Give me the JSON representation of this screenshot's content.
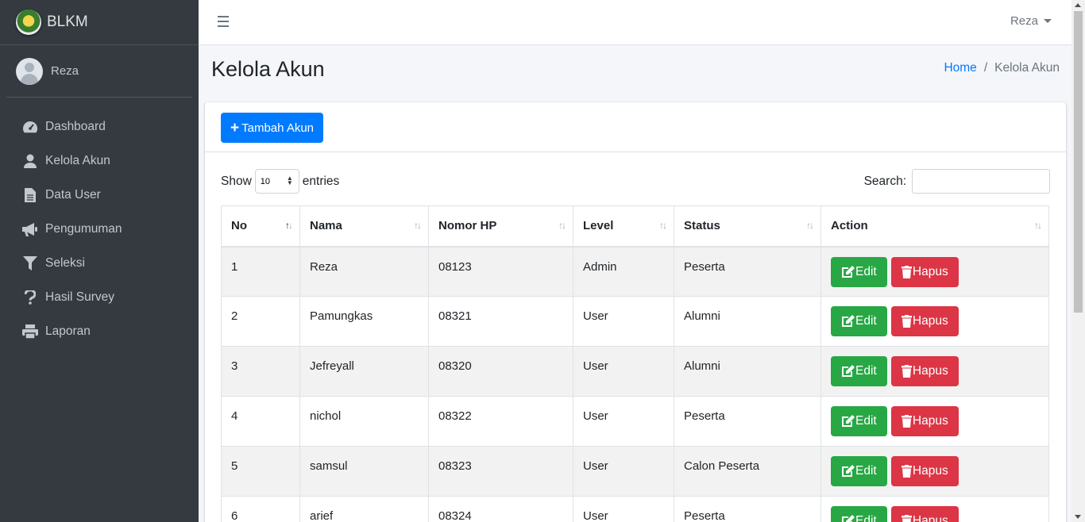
{
  "brand": {
    "name": "BLKM"
  },
  "user": {
    "name": "Reza"
  },
  "sidebar": {
    "items": [
      {
        "label": "Dashboard",
        "icon": "tachometer-icon"
      },
      {
        "label": "Kelola Akun",
        "icon": "user-icon"
      },
      {
        "label": "Data User",
        "icon": "file-icon"
      },
      {
        "label": "Pengumuman",
        "icon": "bullhorn-icon"
      },
      {
        "label": "Seleksi",
        "icon": "filter-icon"
      },
      {
        "label": "Hasil Survey",
        "icon": "question-icon"
      },
      {
        "label": "Laporan",
        "icon": "print-icon"
      }
    ]
  },
  "topbar": {
    "user_menu": "Reza"
  },
  "page": {
    "title": "Kelola Akun"
  },
  "breadcrumb": {
    "home": "Home",
    "current": "Kelola Akun"
  },
  "card": {
    "add_button": "Tambah Akun"
  },
  "table_controls": {
    "show_label": "Show",
    "entries_value": "10",
    "entries_label": "entries",
    "search_label": "Search:"
  },
  "table": {
    "headers": [
      "No",
      "Nama",
      "Nomor HP",
      "Level",
      "Status",
      "Action"
    ],
    "edit_label": "Edit",
    "delete_label": "Hapus",
    "rows": [
      {
        "no": "1",
        "nama": "Reza",
        "hp": "08123",
        "level": "Admin",
        "status": "Peserta"
      },
      {
        "no": "2",
        "nama": "Pamungkas",
        "hp": "08321",
        "level": "User",
        "status": "Alumni"
      },
      {
        "no": "3",
        "nama": "Jefreyall",
        "hp": "08320",
        "level": "User",
        "status": "Alumni"
      },
      {
        "no": "4",
        "nama": "nichol",
        "hp": "08322",
        "level": "User",
        "status": "Peserta"
      },
      {
        "no": "5",
        "nama": "samsul",
        "hp": "08323",
        "level": "User",
        "status": "Calon Peserta"
      },
      {
        "no": "6",
        "nama": "arief",
        "hp": "08324",
        "level": "User",
        "status": "Peserta"
      }
    ]
  },
  "colors": {
    "sidebar_bg": "#343a40",
    "primary": "#007bff",
    "success": "#28a745",
    "danger": "#dc3545"
  }
}
